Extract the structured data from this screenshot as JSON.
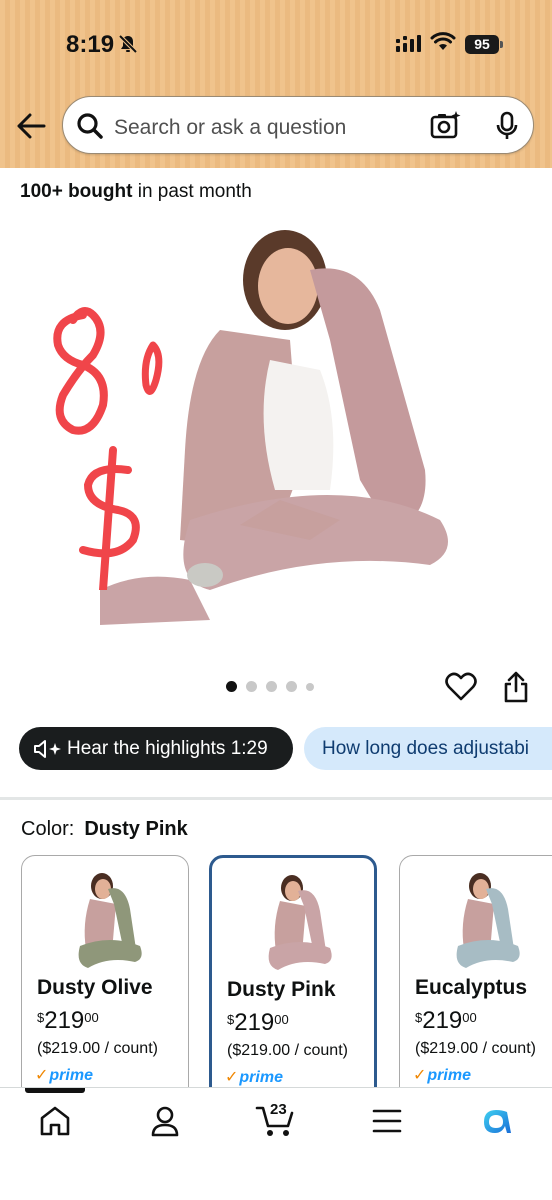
{
  "status_bar": {
    "time": "8:19",
    "battery": "95"
  },
  "search": {
    "placeholder": "Search or ask a question"
  },
  "product": {
    "bought_count": "100+ bought",
    "bought_suffix": " in past month",
    "carousel_total": 5,
    "carousel_active": 1,
    "image_annotation": "80$"
  },
  "pills": {
    "hear_label": "Hear the highlights 1:29",
    "question_label": "How long does adjustabi"
  },
  "color_selector": {
    "label": "Color:",
    "selected": "Dusty Pink",
    "options": [
      {
        "name": "Dusty Olive",
        "currency": "$",
        "price_whole": "219",
        "price_fraction": "00",
        "unit_price": "($219.00 / count)",
        "prime": "prime",
        "pillow_color": "#8f977a"
      },
      {
        "name": "Dusty Pink",
        "currency": "$",
        "price_whole": "219",
        "price_fraction": "00",
        "unit_price": "($219.00 / count)",
        "prime": "prime",
        "pillow_color": "#c9a4a6"
      },
      {
        "name": "Eucalyptus",
        "currency": "$",
        "price_whole": "219",
        "price_fraction": "00",
        "unit_price": "($219.00 / count)",
        "prime": "prime",
        "pillow_color": "#a7bcc4"
      }
    ]
  },
  "bottom_nav": {
    "cart_count": "23"
  },
  "colors": {
    "header_bg": "#f0c38c",
    "selected_border": "#2d5a8e",
    "prime_blue": "#1a98ff",
    "prime_check": "#f08804",
    "question_pill_bg": "#d5e9fb",
    "annotation_red": "#f0454a"
  }
}
